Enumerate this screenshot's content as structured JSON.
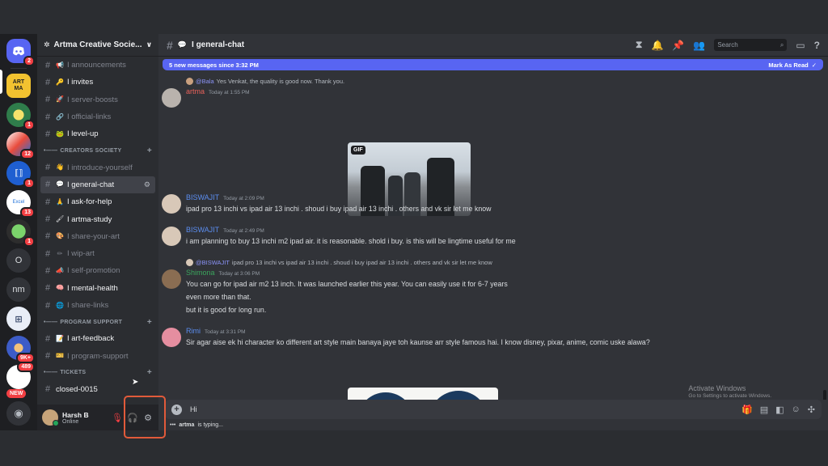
{
  "servers": [
    {
      "label": "",
      "badge": "2",
      "icon": "discord-logo-icon"
    },
    {
      "label": "ART MA",
      "badge": "",
      "icon": "artma-server-icon"
    },
    {
      "label": "",
      "badge": "1",
      "icon": "server-icon"
    },
    {
      "label": "",
      "badge": "12",
      "icon": "server-icon"
    },
    {
      "label": "",
      "badge": "1",
      "icon": "server-icon"
    },
    {
      "label": "",
      "badge": "13",
      "icon": "server-icon"
    },
    {
      "label": "",
      "badge": "1",
      "icon": "server-icon"
    },
    {
      "label": "O",
      "badge": "",
      "icon": "server-icon"
    },
    {
      "label": "nm",
      "badge": "",
      "icon": "server-icon"
    },
    {
      "label": "",
      "badge": "",
      "icon": "server-icon"
    },
    {
      "label": "",
      "badge": "9K+",
      "icon": "server-icon"
    },
    {
      "label": "",
      "badge": "489",
      "icon": "server-icon"
    }
  ],
  "rail_new": "NEW",
  "guild": {
    "name": "Artma Creative Socie...",
    "chevron": "∨"
  },
  "channels_top": [
    {
      "name": "I announcements",
      "unread": false,
      "emoji": "📢"
    },
    {
      "name": "I invites",
      "unread": true,
      "emoji": "🔑"
    },
    {
      "name": "I server-boosts",
      "unread": false,
      "emoji": "🚀"
    },
    {
      "name": "I official-links",
      "unread": false,
      "emoji": "🔗"
    },
    {
      "name": "I level-up",
      "unread": true,
      "emoji": "🐸"
    }
  ],
  "category_creators": "CREATORS SOCIETY",
  "channels_creators": [
    {
      "name": "I introduce-yourself",
      "unread": false,
      "emoji": "👋"
    },
    {
      "name": "I general-chat",
      "unread": true,
      "emoji": "💬",
      "active": true
    },
    {
      "name": "I ask-for-help",
      "unread": true,
      "emoji": "🙏"
    },
    {
      "name": "I artma-study",
      "unread": true,
      "emoji": "🖌"
    },
    {
      "name": "I share-your-art",
      "unread": false,
      "emoji": "🎨"
    },
    {
      "name": "I wip-art",
      "unread": false,
      "emoji": "✏"
    },
    {
      "name": "I self-promotion",
      "unread": false,
      "emoji": "📣"
    },
    {
      "name": "I mental-health",
      "unread": true,
      "emoji": "🧠"
    },
    {
      "name": "I share-links",
      "unread": false,
      "emoji": "🌐"
    }
  ],
  "category_program": "PROGRAM SUPPORT",
  "channels_program": [
    {
      "name": "I art-feedback",
      "unread": true,
      "emoji": "📝"
    },
    {
      "name": "I program-support",
      "unread": false,
      "emoji": "🎫"
    }
  ],
  "category_tickets": "TICKETS",
  "channels_tickets": [
    {
      "name": "closed-0015",
      "unread": true,
      "emoji": ""
    }
  ],
  "user": {
    "name": "Harsh B",
    "status": "Online"
  },
  "header": {
    "channel": "I general-chat",
    "search_placeholder": "Search"
  },
  "new_messages": {
    "text": "5 new messages since 3:32 PM",
    "action": "Mark As Read"
  },
  "messages": [
    {
      "reply_to": "@Bala",
      "reply_text": "Yes Venkat, the quality is good now.  Thank you.",
      "author": "artma",
      "time": "Today at 1:55 PM",
      "lines": [],
      "gif_label": "GIF"
    },
    {
      "author": "BISWAJIT",
      "time": "Today at 2:09 PM",
      "lines": [
        "ipad pro 13 inchi  vs ipad air 13 inchi . shoud i buy ipad air 13 inchi . others and vk sir let me know"
      ]
    },
    {
      "author": "BISWAJIT",
      "time": "Today at 2:49 PM",
      "lines": [
        "i am planning to buy 13 inchi m2 ipad air. it is reasonable. shold i buy. is this will be lingtime useful for me"
      ]
    },
    {
      "reply_to": "@BISWAJIT",
      "reply_text": "ipad pro 13 inchi  vs ipad air 13 inchi . shoud i buy ipad air 13 inchi . others and vk sir let me know",
      "author": "Shimona",
      "time": "Today at 3:06 PM",
      "lines": [
        "You can go for ipad air m2 13 inch. It was launched earlier this year. You can easily use it for 6-7 years",
        "even more than that.",
        "but it is good for long run."
      ]
    },
    {
      "author": "Rimi",
      "time": "Today at 3:31 PM",
      "lines": [
        "Sir agar aise ek hi character ko different art style main banaya jaye toh kaunse arr style famous hai. I know disney, pixar, anime, comic uske alawa?"
      ]
    }
  ],
  "composer": {
    "value": "Hi"
  },
  "typing": {
    "user": "artma",
    "suffix": "is typing..."
  },
  "watermark": {
    "title": "Activate Windows",
    "sub": "Go to Settings to activate Windows."
  },
  "colors": {
    "accent": "#5865f2",
    "artma": "#e8615a",
    "biswajit": "#5b8def",
    "shimona": "#3ba55d",
    "rimi": "#5b8def",
    "highlight": "#e15a3a"
  }
}
